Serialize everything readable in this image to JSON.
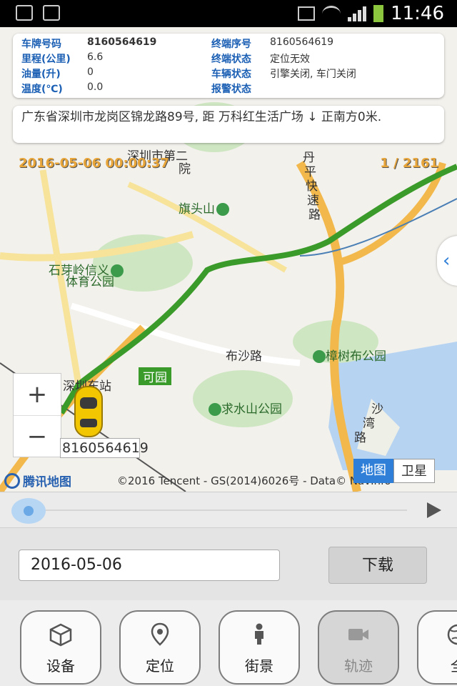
{
  "status_bar": {
    "time": "11:46"
  },
  "vehicle_info": {
    "rows": [
      {
        "label": "车牌号码",
        "value": "8160564619"
      },
      {
        "label": "里程(公里)",
        "value": "6.6"
      },
      {
        "label": "油量(升)",
        "value": "0"
      },
      {
        "label": "温度(℃)",
        "value": "0.0"
      },
      {
        "label": "终端序号",
        "value": "8160564619"
      },
      {
        "label": "终端状态",
        "value": "定位无效"
      },
      {
        "label": "车辆状态",
        "value": "引擎关闭, 车门关闭"
      },
      {
        "label": "报警状态",
        "value": ""
      }
    ]
  },
  "address": "广东省深圳市龙岗区锦龙路89号, 距 万科红生活广场 ↓ 正南方0米.",
  "track": {
    "timestamp": "2016-05-06 00:00:37",
    "counter": "1 / 2161"
  },
  "map": {
    "labels": {
      "hospital": "深圳市第二",
      "hospital2": "院",
      "qitoushan": "旗头山",
      "shiyaling": "石芽岭信义",
      "sports_park": "体育公园",
      "bushalu": "布沙路",
      "zhangshubu": "樟树布公园",
      "shenzhen_east": "深圳东站",
      "keyuan": "可园",
      "qiushuishan": "求水山公园",
      "danping1": "丹",
      "danping2": "平",
      "danping3": "快",
      "danping4": "速",
      "danping5": "路",
      "shawan1": "沙",
      "shawan2": "湾",
      "shawan3": "路"
    },
    "vehicle_plate": "8160564619",
    "zoom_in": "+",
    "zoom_out": "−",
    "brand": "腾讯地图",
    "copyright": "©2016 Tencent - GS(2014)6026号 - Data© NavInfo",
    "type_map": "地图",
    "type_satellite": "卫星",
    "side_tab": "‹"
  },
  "date_picker": {
    "value": "2016-05-06",
    "download_label": "下载"
  },
  "nav": [
    {
      "label": "设备",
      "icon": "cube-icon"
    },
    {
      "label": "定位",
      "icon": "location-pin-icon"
    },
    {
      "label": "街景",
      "icon": "person-icon"
    },
    {
      "label": "轨迹",
      "icon": "video-camera-icon"
    },
    {
      "label": "全",
      "icon": "globe-icon"
    }
  ]
}
